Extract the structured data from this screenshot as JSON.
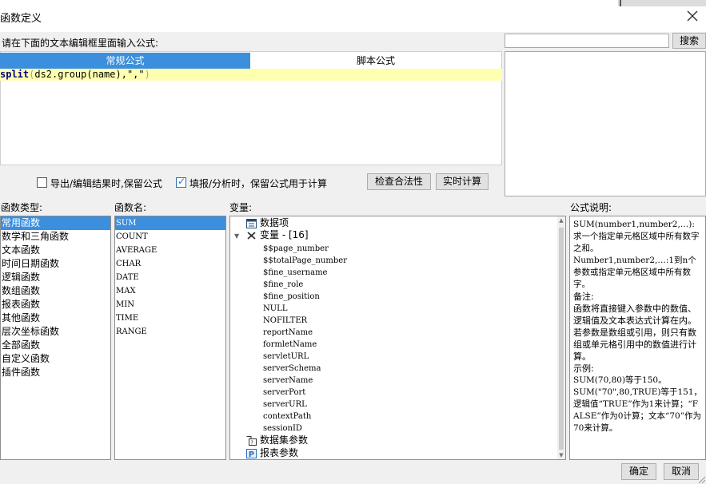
{
  "window": {
    "title": "函数定义",
    "close_icon": "close-icon"
  },
  "editor": {
    "instruction": "请在下面的文本编辑框里面输入公式:",
    "tabs": [
      {
        "label": "常规公式",
        "active": true
      },
      {
        "label": "脚本公式",
        "active": false
      }
    ],
    "code": {
      "func": "split",
      "open": "(",
      "arg1": "ds2.group(name),",
      "arg2": "\",\"",
      "close": ")"
    },
    "accent_color": "#3c8fdd",
    "highlight_color": "#ffffb0"
  },
  "search": {
    "value": "",
    "button_label": "搜索"
  },
  "options": {
    "keep_formula_export": {
      "label": "导出/编辑结果时,保留公式",
      "checked": false
    },
    "keep_formula_fill": {
      "label": "填报/分析时，保留公式用于计算",
      "checked": true
    },
    "validate_button": "检查合法性",
    "realtime_button": "实时计算"
  },
  "function_types": {
    "label": "函数类型:",
    "items": [
      "常用函数",
      "数学和三角函数",
      "文本函数",
      "时间日期函数",
      "逻辑函数",
      "数组函数",
      "报表函数",
      "其他函数",
      "层次坐标函数",
      "全部函数",
      "自定义函数",
      "插件函数"
    ],
    "selected_index": 0
  },
  "function_names": {
    "label": "函数名:",
    "items": [
      "SUM",
      "COUNT",
      "AVERAGE",
      "CHAR",
      "DATE",
      "MAX",
      "MIN",
      "TIME",
      "RANGE"
    ],
    "selected_index": 0
  },
  "variables": {
    "label": "变量:",
    "data_item": "数据项",
    "var_group": "变量 - [16]",
    "var_children": [
      "$$page_number",
      "$$totalPage_number",
      "$fine_username",
      "$fine_role",
      "$fine_position",
      "NULL",
      "NOFILTER",
      "reportName",
      "formletName",
      "servletURL",
      "serverSchema",
      "serverName",
      "serverPort",
      "serverURL",
      "contextPath",
      "sessionID"
    ],
    "dataset_params": "数据集参数",
    "report_params": "报表参数",
    "expand_icon": "chevron-down-icon"
  },
  "description": {
    "label": "公式说明:",
    "lines": [
      "SUM(number1,number2,…):求一个指定单元格区域中所有数字之和。",
      "Number1,number2,…:1到n个参数或指定单元格区域中所有数字。",
      "备注:",
      "函数将直接键入参数中的数值、逻辑值及文本表达式计算在内。若参数是数组或引用，则只有数组或单元格引用中的数值进行计算。",
      "示例:",
      "SUM(70,80)等于150。",
      "SUM(\"70\",80,TRUE)等于151，逻辑值“TRUE”作为1来计算；“FALSE”作为0计算；文本“70”作为70来计算。"
    ]
  },
  "footer": {
    "ok_label": "确定",
    "cancel_label": "取消"
  }
}
